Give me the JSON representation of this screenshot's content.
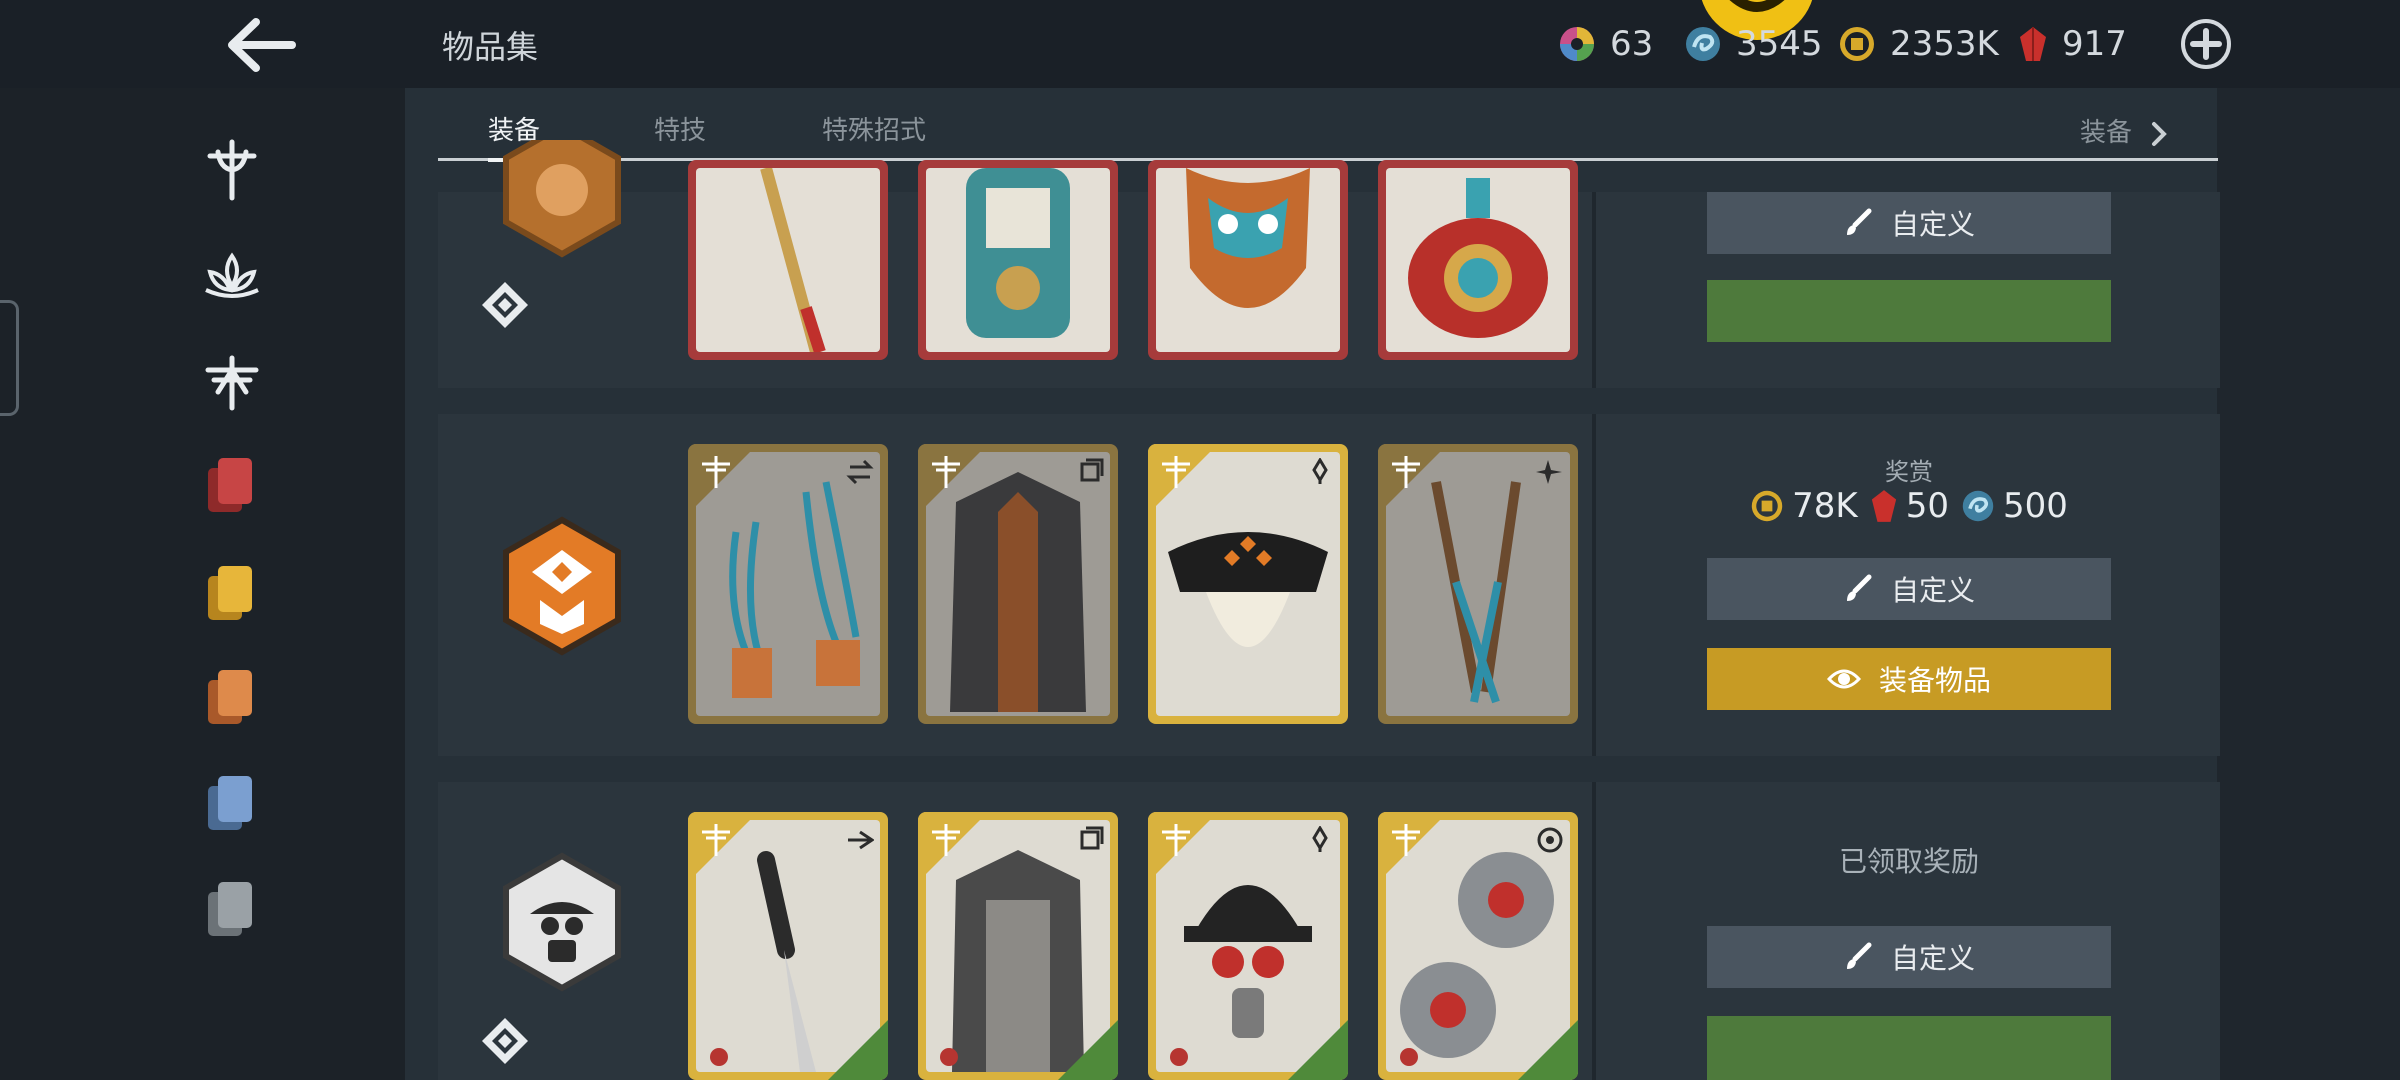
{
  "header": {
    "title": "物品集",
    "currencies": [
      {
        "icon": "color-wheel-icon",
        "value": "63"
      },
      {
        "icon": "spirit-swirl-icon",
        "value": "3545"
      },
      {
        "icon": "coin-icon",
        "value": "2353K"
      },
      {
        "icon": "ruby-gem-icon",
        "value": "917"
      }
    ]
  },
  "tabs": [
    {
      "label": "装备",
      "active": true
    },
    {
      "label": "特技",
      "active": false
    },
    {
      "label": "特殊招式",
      "active": false
    }
  ],
  "tab_more_label": "装备",
  "rows": [
    {
      "buttons": {
        "customize": "自定义",
        "green": ""
      }
    },
    {
      "reward": {
        "title": "奖赏",
        "coins": "78K",
        "gems": "50",
        "spirit": "500"
      },
      "buttons": {
        "customize": "自定义",
        "equip": "装备物品"
      }
    },
    {
      "status": "已领取奖励",
      "buttons": {
        "customize": "自定义",
        "green": ""
      }
    }
  ],
  "colors": {
    "gold_button": "#c79b24",
    "green_button": "#4e7a3c",
    "grey_button": "#4a5560"
  }
}
